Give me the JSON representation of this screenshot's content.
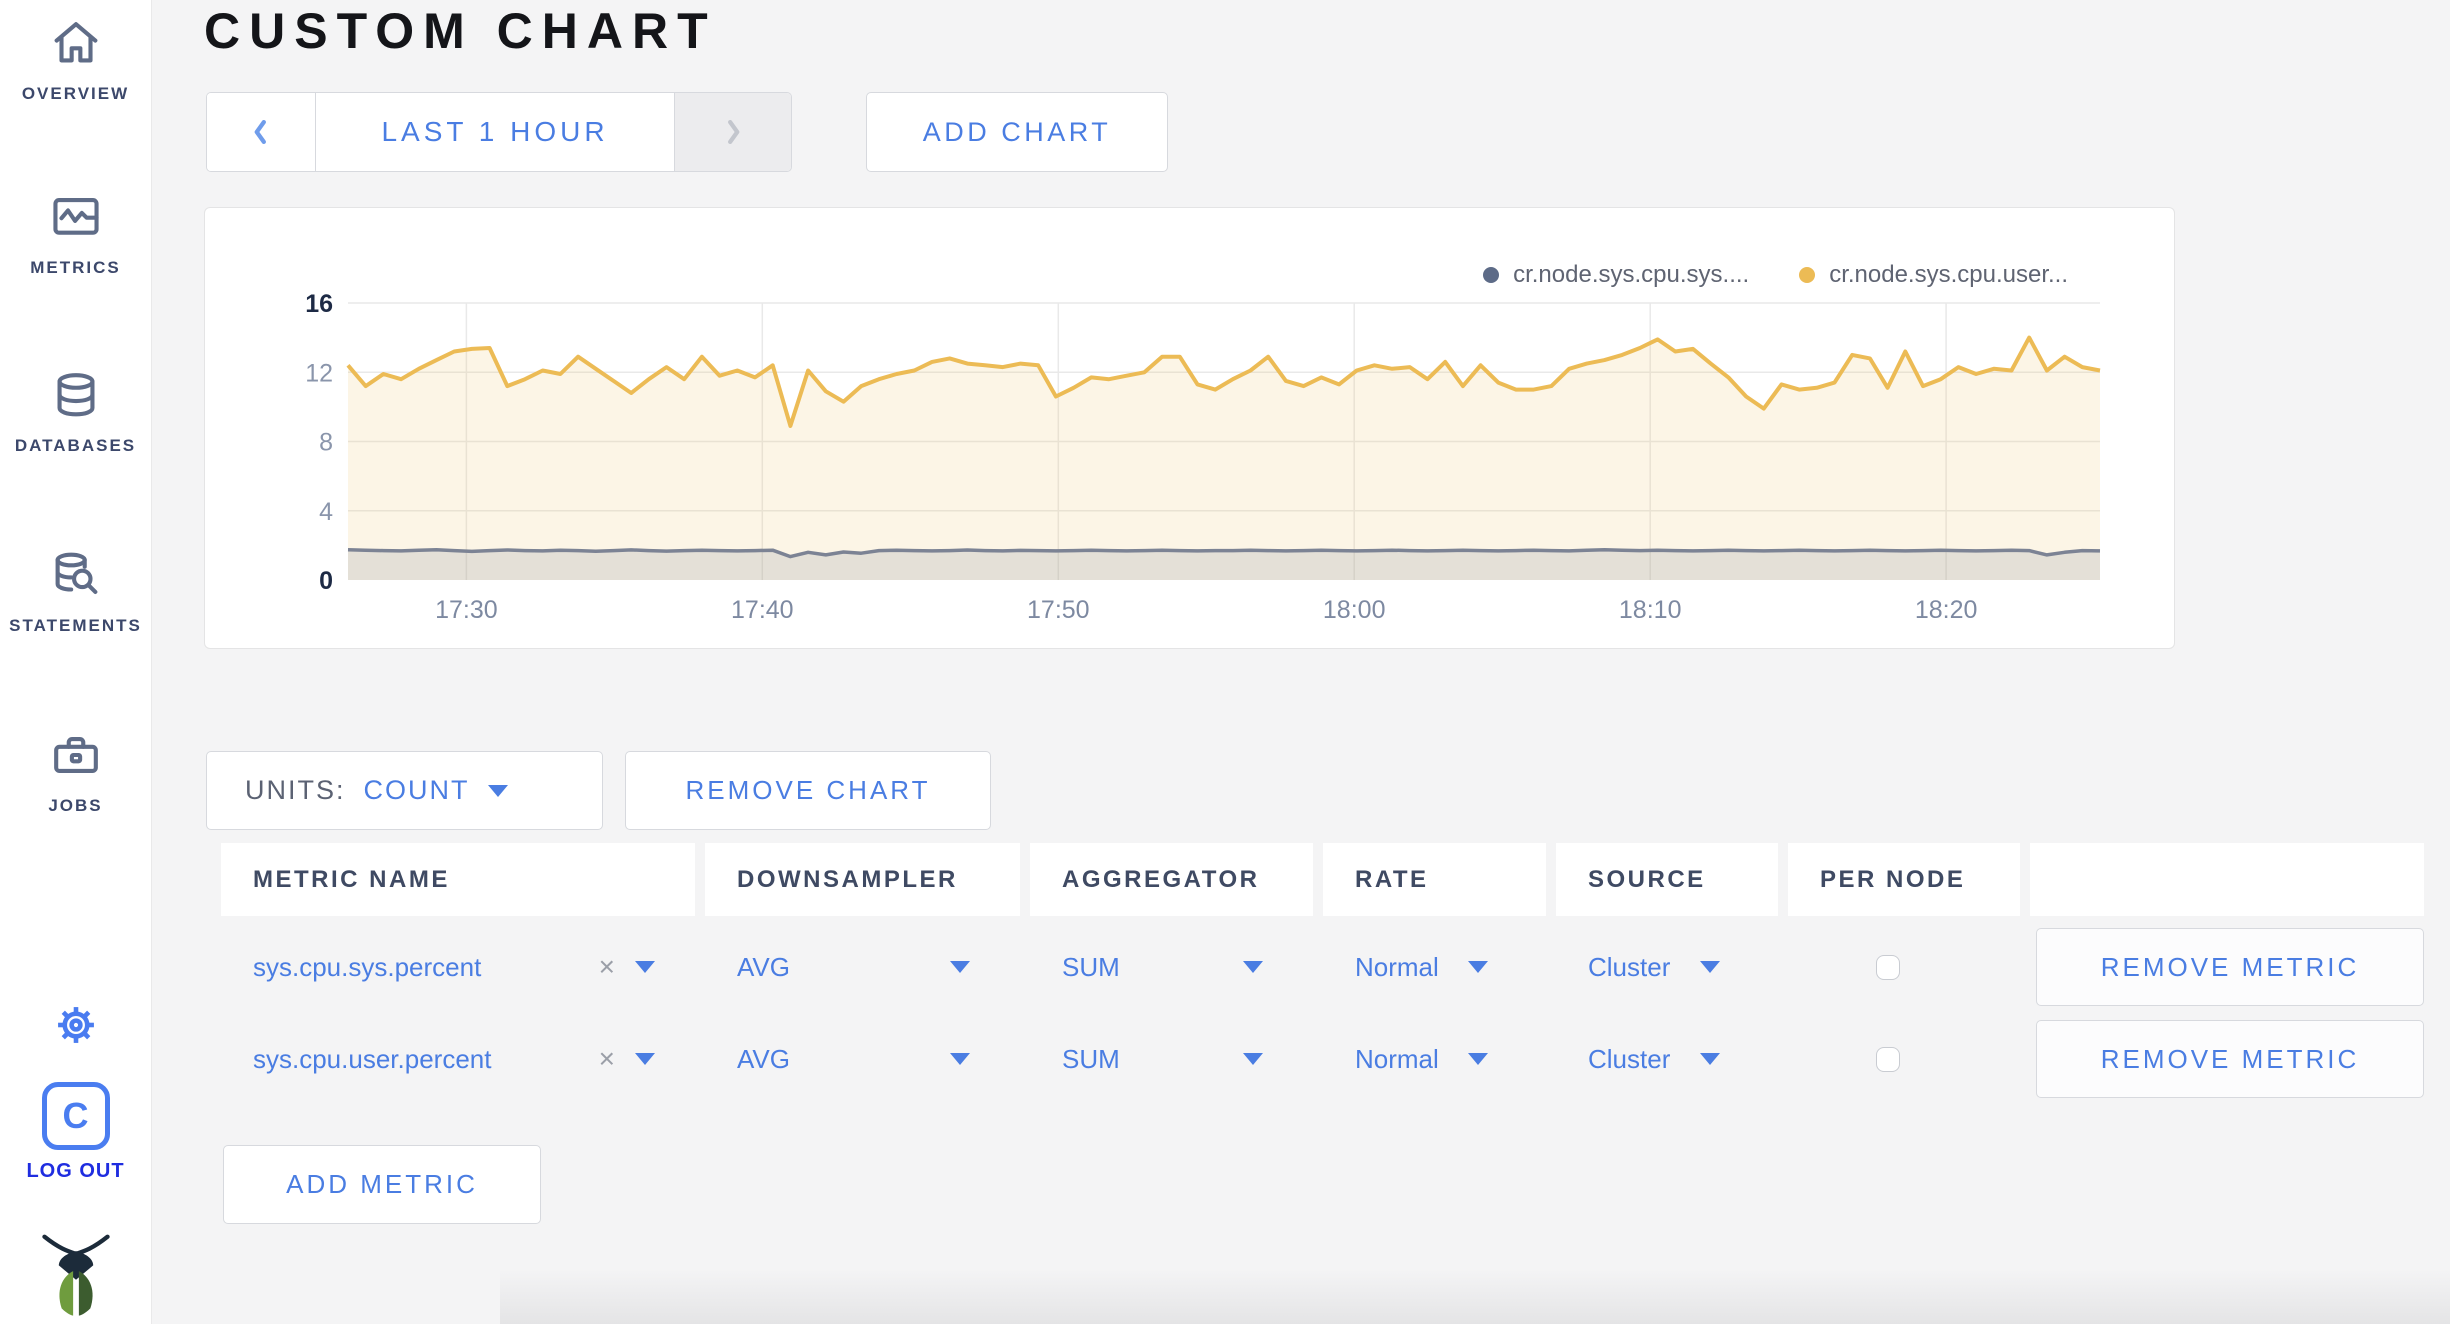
{
  "header": {
    "title": "CUSTOM CHART"
  },
  "sidebar": {
    "items": [
      {
        "label": "OVERVIEW",
        "icon": "home-icon"
      },
      {
        "label": "METRICS",
        "icon": "metrics-icon"
      },
      {
        "label": "DATABASES",
        "icon": "database-icon"
      },
      {
        "label": "STATEMENTS",
        "icon": "statements-icon"
      },
      {
        "label": "JOBS",
        "icon": "briefcase-icon"
      }
    ],
    "logout_label": "LOG OUT"
  },
  "time_selector": {
    "range_label": "LAST 1 HOUR"
  },
  "toolbar": {
    "add_chart_label": "ADD CHART"
  },
  "units": {
    "label": "UNITS:",
    "value": "COUNT"
  },
  "chart_actions": {
    "remove_chart_label": "REMOVE CHART",
    "add_metric_label": "ADD METRIC"
  },
  "table": {
    "columns": [
      "METRIC NAME",
      "DOWNSAMPLER",
      "AGGREGATOR",
      "RATE",
      "SOURCE",
      "PER NODE",
      ""
    ],
    "clear_glyph": "×",
    "remove_metric_label": "REMOVE METRIC",
    "rows": [
      {
        "metric": "sys.cpu.sys.percent",
        "downsampler": "AVG",
        "aggregator": "SUM",
        "rate": "Normal",
        "source": "Cluster",
        "per_node_checked": false
      },
      {
        "metric": "sys.cpu.user.percent",
        "downsampler": "AVG",
        "aggregator": "SUM",
        "rate": "Normal",
        "source": "Cluster",
        "per_node_checked": false
      }
    ]
  },
  "chart_data": {
    "type": "area",
    "title": "",
    "xlabel": "",
    "ylabel": "",
    "grid": true,
    "legend_position": "top-right",
    "x_axis": {
      "tick_labels": [
        "17:30",
        "17:40",
        "17:50",
        "18:00",
        "18:10",
        "18:20"
      ],
      "tick_minutes": [
        4,
        14,
        24,
        34,
        44,
        54
      ],
      "domain_minutes": [
        0,
        59.2
      ]
    },
    "y_axis": {
      "ticks": [
        0,
        4,
        8,
        12,
        16
      ],
      "range": [
        0,
        16
      ]
    },
    "legend": [
      {
        "label": "cr.node.sys.cpu.sys....",
        "color": "#5d6b87"
      },
      {
        "label": "cr.node.sys.cpu.user...",
        "color": "#ecbb55"
      }
    ],
    "series": [
      {
        "name": "cr.node.sys.cpu.sys....",
        "color": "#7c8394",
        "fill": "rgba(124,131,148,0.18)",
        "values": [
          1.75,
          1.72,
          1.7,
          1.68,
          1.72,
          1.75,
          1.7,
          1.65,
          1.7,
          1.73,
          1.7,
          1.68,
          1.72,
          1.7,
          1.66,
          1.7,
          1.74,
          1.7,
          1.67,
          1.7,
          1.72,
          1.7,
          1.68,
          1.7,
          1.72,
          1.35,
          1.6,
          1.45,
          1.62,
          1.55,
          1.7,
          1.72,
          1.7,
          1.68,
          1.7,
          1.73,
          1.7,
          1.68,
          1.71,
          1.7,
          1.68,
          1.7,
          1.72,
          1.7,
          1.68,
          1.7,
          1.72,
          1.7,
          1.68,
          1.7,
          1.7,
          1.72,
          1.7,
          1.68,
          1.7,
          1.72,
          1.7,
          1.68,
          1.7,
          1.72,
          1.7,
          1.68,
          1.7,
          1.72,
          1.7,
          1.68,
          1.7,
          1.72,
          1.7,
          1.68,
          1.72,
          1.75,
          1.72,
          1.7,
          1.72,
          1.7,
          1.68,
          1.7,
          1.72,
          1.7,
          1.68,
          1.7,
          1.72,
          1.7,
          1.68,
          1.7,
          1.72,
          1.7,
          1.68,
          1.7,
          1.72,
          1.7,
          1.68,
          1.7,
          1.72,
          1.7,
          1.45,
          1.6,
          1.7,
          1.68
        ]
      },
      {
        "name": "cr.node.sys.cpu.user...",
        "color": "#ecbb55",
        "fill": "rgba(236,187,85,0.15)",
        "values": [
          12.4,
          11.2,
          11.9,
          11.6,
          12.2,
          12.7,
          13.2,
          13.35,
          13.4,
          11.2,
          11.6,
          12.1,
          11.9,
          12.9,
          12.2,
          11.5,
          10.8,
          11.6,
          12.3,
          11.6,
          12.9,
          11.8,
          12.1,
          11.7,
          12.4,
          8.9,
          12.1,
          10.9,
          10.3,
          11.2,
          11.6,
          11.9,
          12.1,
          12.6,
          12.8,
          12.5,
          12.4,
          12.3,
          12.5,
          12.4,
          10.6,
          11.1,
          11.7,
          11.6,
          11.8,
          12.0,
          12.9,
          12.9,
          11.3,
          11.0,
          11.6,
          12.1,
          12.9,
          11.5,
          11.2,
          11.7,
          11.3,
          12.1,
          12.4,
          12.2,
          12.3,
          11.6,
          12.6,
          11.2,
          12.4,
          11.4,
          11.0,
          11.0,
          11.2,
          12.2,
          12.5,
          12.7,
          13.0,
          13.4,
          13.9,
          13.2,
          13.35,
          12.5,
          11.7,
          10.6,
          9.9,
          11.3,
          11.0,
          11.1,
          11.4,
          13.0,
          12.8,
          11.1,
          13.2,
          11.2,
          11.6,
          12.3,
          11.9,
          12.2,
          12.1,
          14.0,
          12.1,
          12.9,
          12.3,
          12.1
        ]
      }
    ]
  }
}
